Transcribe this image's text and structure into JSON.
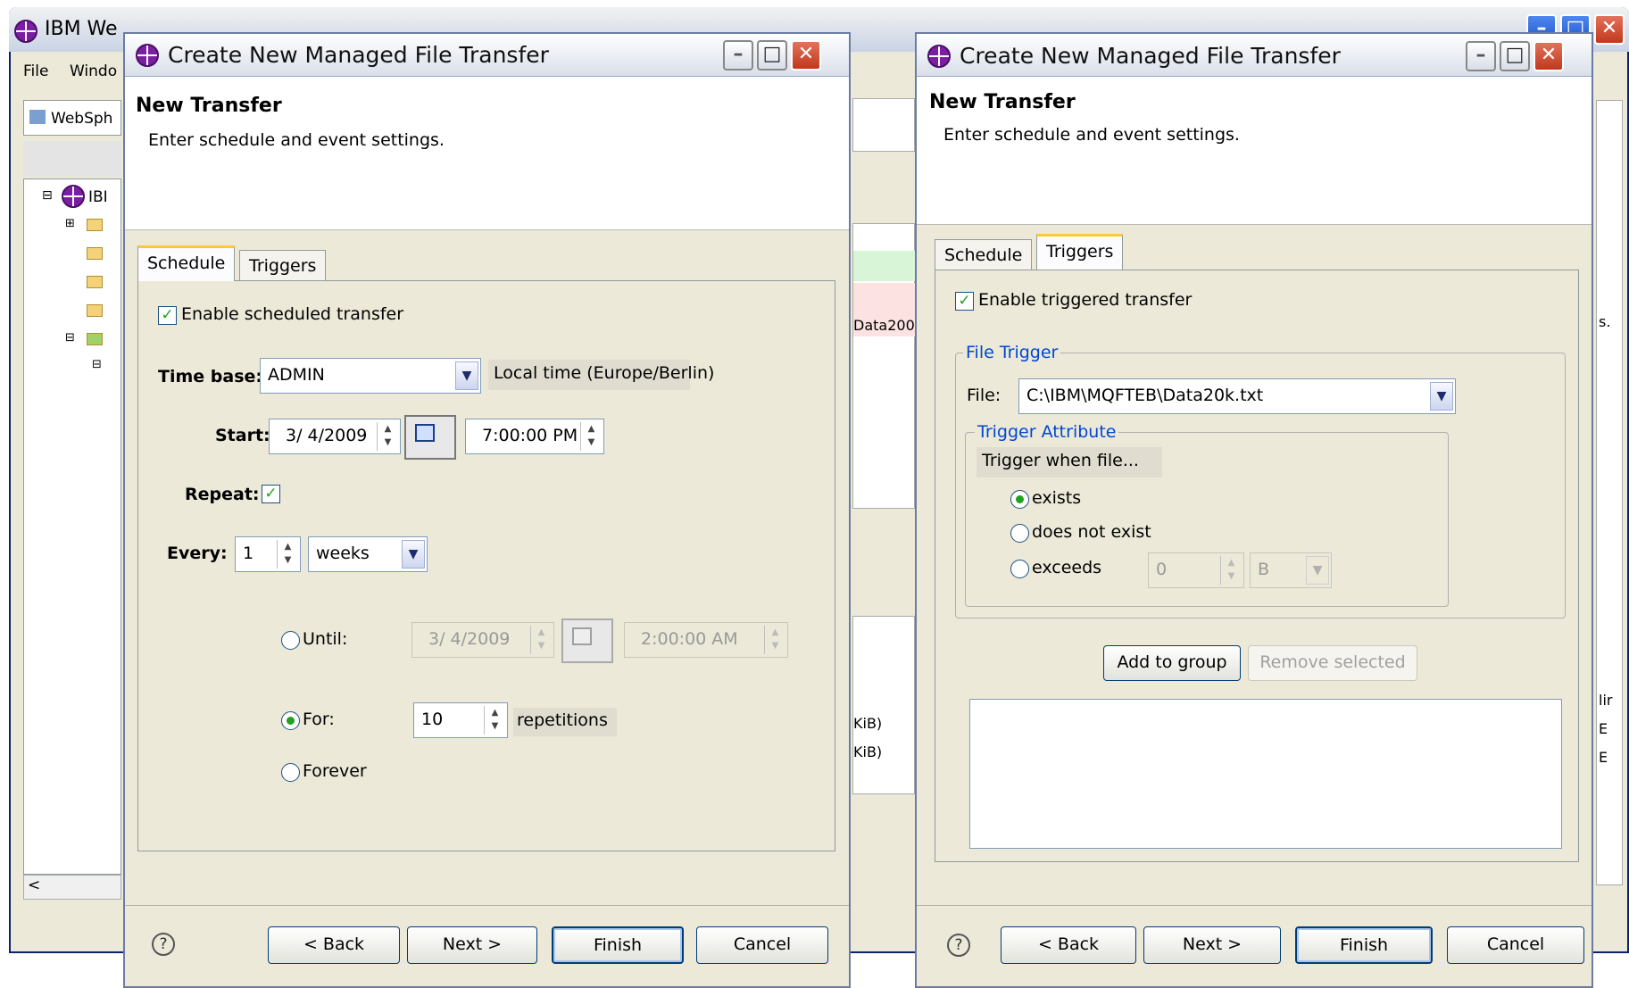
{
  "background_window": {
    "title": "IBM We",
    "menu": [
      "File",
      "Windo"
    ],
    "view_tab": "WebSph",
    "tree_root": "IBI",
    "fragments": [
      "Data200",
      "s.",
      "KiB)",
      "KiB)",
      "lir",
      "E",
      "E"
    ],
    "scroll_left": "<"
  },
  "dialog_left": {
    "title": "Create New Managed File Transfer",
    "banner_title": "New Transfer",
    "banner_subtitle": "Enter schedule and event settings.",
    "tabs": [
      "Schedule",
      "Triggers"
    ],
    "enable_label": "Enable scheduled transfer",
    "enable_checked": true,
    "time_base_label": "Time base:",
    "time_base_value": "ADMIN",
    "time_zone": "Local time (Europe/Berlin)",
    "start_label": "Start:",
    "start_date": "3/ 4/2009",
    "start_time": "7:00:00 PM",
    "repeat_label": "Repeat:",
    "repeat_checked": true,
    "every_label": "Every:",
    "every_value": "1",
    "every_unit": "weeks",
    "until_label": "Until:",
    "until_date": "3/ 4/2009",
    "until_time": "2:00:00 AM",
    "for_label": "For:",
    "for_value": "10",
    "for_unit": "repetitions",
    "forever_label": "Forever",
    "selected_option": "For",
    "buttons": {
      "back": "< Back",
      "next": "Next >",
      "finish": "Finish",
      "cancel": "Cancel"
    },
    "help": "?"
  },
  "dialog_right": {
    "title": "Create New Managed File Transfer",
    "banner_title": "New Transfer",
    "banner_subtitle": "Enter schedule and event settings.",
    "tabs": [
      "Schedule",
      "Triggers"
    ],
    "enable_label": "Enable triggered transfer",
    "enable_checked": true,
    "file_trigger_group": "File Trigger",
    "file_label": "File:",
    "file_value": "C:\\IBM\\MQFTEB\\Data20k.txt",
    "trigger_attribute_group": "Trigger Attribute",
    "trigger_when": "Trigger when file...",
    "opt_exists": "exists",
    "opt_not_exist": "does not exist",
    "opt_exceeds": "exceeds",
    "selected_option": "exists",
    "exceeds_value": "0",
    "exceeds_unit": "B",
    "add_group": "Add to group",
    "remove_selected": "Remove selected",
    "buttons": {
      "back": "< Back",
      "next": "Next >",
      "finish": "Finish",
      "cancel": "Cancel"
    },
    "help": "?"
  },
  "colors": {
    "accent_tab": "#ffc83c",
    "check_green": "#21a121",
    "group_label": "#0046d5",
    "title_close": "#c1381c"
  }
}
